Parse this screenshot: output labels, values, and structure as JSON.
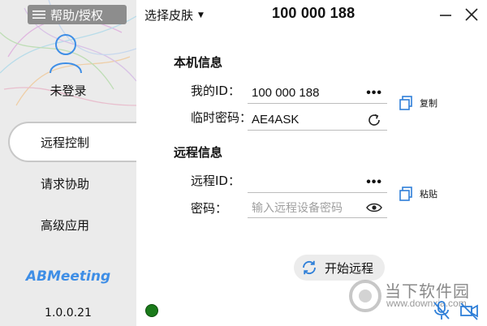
{
  "sidebar": {
    "help_label": "帮助/授权",
    "login_status": "未登录",
    "nav": [
      {
        "label": "远程控制",
        "active": true
      },
      {
        "label": "请求协助",
        "active": false
      },
      {
        "label": "高级应用",
        "active": false
      }
    ],
    "brand": "ABMeeting",
    "version": "1.0.0.21",
    "connection_status_color": "#1a7a1a"
  },
  "header": {
    "skin_label": "选择皮肤",
    "id_display": "100 000 188"
  },
  "local_info": {
    "title": "本机信息",
    "my_id_label": "我的ID：",
    "my_id_value": "100 000 188",
    "temp_pw_label": "临时密码：",
    "temp_pw_value": "AE4ASK",
    "copy_label": "复制"
  },
  "remote_info": {
    "title": "远程信息",
    "remote_id_label": "远程ID：",
    "remote_id_value": "",
    "password_label": "密码：",
    "password_placeholder": "输入远程设备密码",
    "paste_label": "粘贴"
  },
  "actions": {
    "start_label": "开始远程"
  },
  "watermark": {
    "text": "当下软件园",
    "url": "www.downxia.com"
  },
  "colors": {
    "accent": "#3e8ee6",
    "icon_blue": "#2f7fd8"
  }
}
